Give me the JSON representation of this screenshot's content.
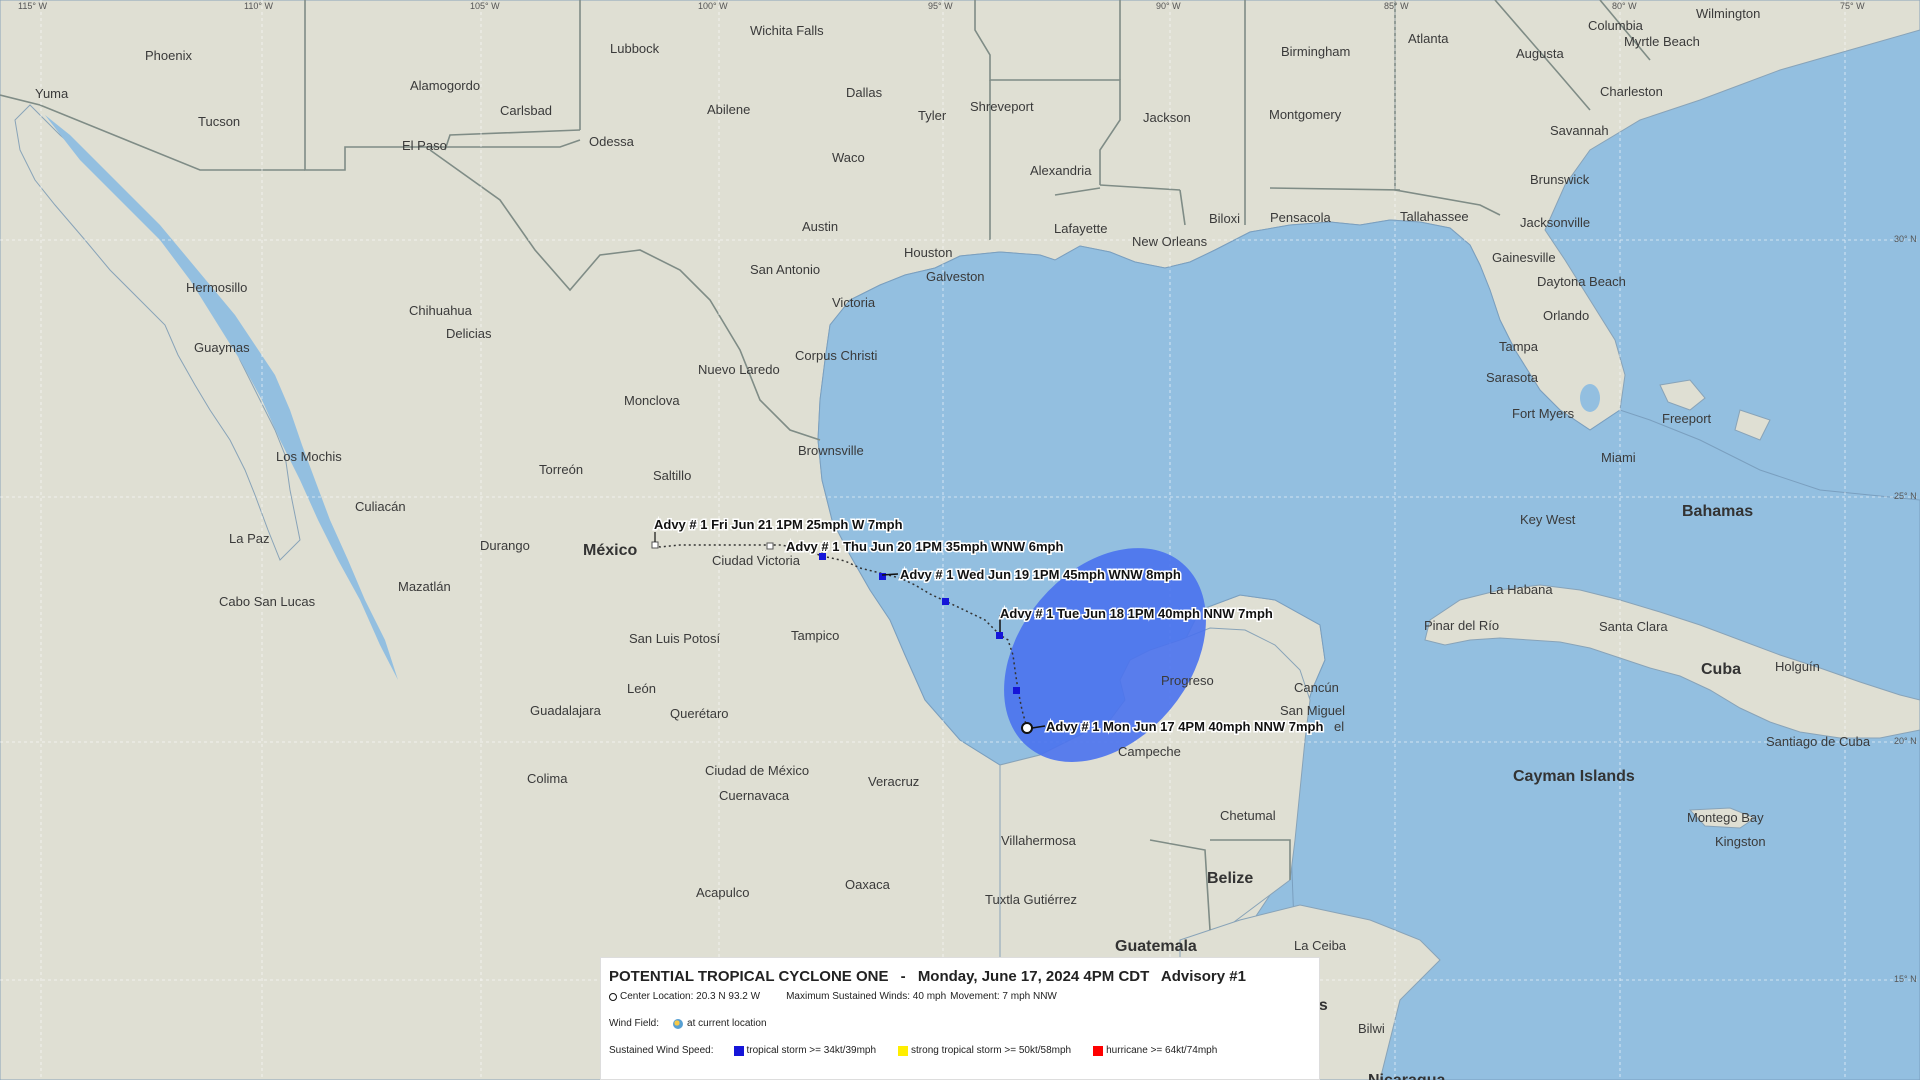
{
  "map": {
    "longitude_labels": [
      "115° W",
      "110° W",
      "105° W",
      "100° W",
      "95° W",
      "90° W",
      "85° W",
      "80° W",
      "75° W"
    ],
    "latitude_labels": [
      "30° N",
      "25° N",
      "20° N",
      "15° N"
    ],
    "countries": [
      "México",
      "Bahamas",
      "Cuba",
      "Cayman Islands",
      "Belize",
      "Guatemala"
    ],
    "cities": [
      "Yuma",
      "Phoenix",
      "Tucson",
      "Alamogordo",
      "Carlsbad",
      "El Paso",
      "Lubbock",
      "Wichita Falls",
      "Dallas",
      "Abilene",
      "Odessa",
      "Waco",
      "Tyler",
      "Shreveport",
      "Austin",
      "San Antonio",
      "Houston",
      "Galveston",
      "Victoria",
      "Corpus Christi",
      "Brownsville",
      "Alexandria",
      "Lafayette",
      "New Orleans",
      "Jackson",
      "Birmingham",
      "Montgomery",
      "Atlanta",
      "Biloxi",
      "Pensacola",
      "Tallahassee",
      "Jacksonville",
      "Augusta",
      "Columbia",
      "Wilmington",
      "Myrtle Beach",
      "Charleston",
      "Savannah",
      "Brunswick",
      "Gainesville",
      "Daytona Beach",
      "Orlando",
      "Tampa",
      "Sarasota",
      "Fort Myers",
      "Miami",
      "Key West",
      "Freeport",
      "La Habana",
      "Pinar del Río",
      "Santa Clara",
      "Holguín",
      "Santiago de Cuba",
      "Montego Bay",
      "Kingston",
      "Hermosillo",
      "Guaymas",
      "Chihuahua",
      "Delicias",
      "Los Mochis",
      "La Paz",
      "Cabo San Lucas",
      "Culiacán",
      "Mazatlán",
      "Durango",
      "Torreón",
      "Monclova",
      "Nuevo Laredo",
      "Saltillo",
      "Ciudad Victoria",
      "Tampico",
      "San Luis Potosí",
      "León",
      "Querétaro",
      "Guadalajara",
      "Colima",
      "Ciudad de México",
      "Cuernavaca",
      "Veracruz",
      "Acapulco",
      "Oaxaca",
      "Villahermosa",
      "Tuxtla Gutiérrez",
      "Campeche",
      "Progreso",
      "Cancún",
      "San Miguel",
      "Chetumal",
      "La Ceiba",
      "Bilwi",
      "as",
      "el",
      "Nicaragua"
    ],
    "forecast_points": [
      "Advy # 1 Mon Jun 17 4PM 40mph NNW 7mph",
      "Advy # 1 Tue Jun 18 1PM 40mph NNW 7mph",
      "Advy # 1 Wed Jun 19 1PM 45mph WNW 8mph",
      "Advy # 1 Thu Jun 20 1PM 35mph WNW 6mph",
      "Advy # 1 Fri Jun 21 1PM 25mph W 7mph"
    ]
  },
  "legend": {
    "title_storm": "POTENTIAL TROPICAL CYCLONE ONE",
    "title_sep": "-",
    "title_date": "Monday, June 17, 2024 4PM CDT",
    "title_advisory": "Advisory #1",
    "center_location": "Center Location: 20.3 N 93.2 W",
    "max_winds": "Maximum Sustained Winds: 40 mph",
    "movement": "Movement: 7 mph NNW",
    "wind_field_label": "Wind Field:",
    "wind_field_value": "at current location",
    "sustained_label": "Sustained Wind Speed:",
    "ts": "tropical storm >= 34kt/39mph",
    "sts": "strong tropical storm >= 50kt/58mph",
    "hu": "hurricane >= 64kt/74mph",
    "colors": {
      "ts": "#1515d9",
      "sts": "#ffee00",
      "hu": "#ff0000",
      "wind_field": "#4a72ee"
    }
  }
}
